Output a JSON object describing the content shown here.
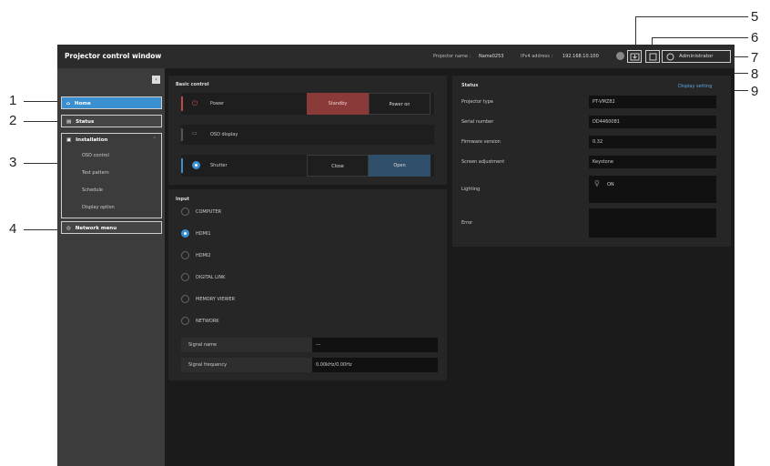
{
  "callouts": [
    "1",
    "2",
    "3",
    "4",
    "5",
    "6",
    "7",
    "8",
    "9"
  ],
  "titlebar": {
    "title": "Projector control window",
    "projector_name_label": "Projector name :",
    "projector_name_value": "Name0253",
    "ipv4_label": "IPv4 address :",
    "ipv4_value": "192.168.10.100",
    "admin_label": "Administrator"
  },
  "sidebar": {
    "home": "Home",
    "status": "Status",
    "installation": "Installation",
    "installation_items": [
      "OSD control",
      "Test pattern",
      "Schedule",
      "Display option"
    ],
    "network_menu": "Network menu"
  },
  "basic_control": {
    "title": "Basic control",
    "power_label": "Power",
    "standby": "Standby",
    "power_on": "Power on",
    "osd_label": "OSD display",
    "shutter_label": "Shutter",
    "close": "Close",
    "open": "Open"
  },
  "input": {
    "title": "Input",
    "options": [
      "COMPUTER",
      "HDMI1",
      "HDMI2",
      "DIGITAL LINK",
      "MEMORY VIEWER",
      "NETWORK"
    ],
    "selected": "HDMI1",
    "signal_name_label": "Signal name",
    "signal_name_value": "---",
    "signal_freq_label": "Signal frequency",
    "signal_freq_value": "0.00kHz/0.00Hz"
  },
  "status": {
    "title": "Status",
    "display_setting": "Display setting",
    "rows": [
      {
        "label": "Projector type",
        "value": "PT-VMZ82"
      },
      {
        "label": "Serial number",
        "value": "DD4460081"
      },
      {
        "label": "Firmware version",
        "value": "0.32"
      },
      {
        "label": "Screen adjustment",
        "value": "Keystone"
      }
    ],
    "lighting_label": "Lighting",
    "lighting_value": "ON",
    "error_label": "Error"
  },
  "colors": {
    "accent": "#3a8fd0",
    "standby_red": "#8b3a3a",
    "open_blue": "#2f4f6a"
  }
}
